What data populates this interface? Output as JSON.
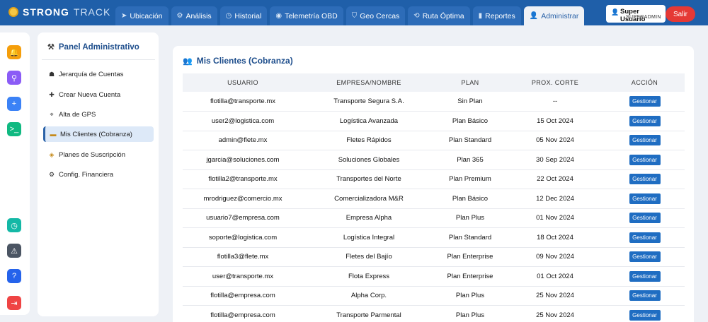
{
  "app": {
    "brand_primary": "STRONG",
    "brand_secondary": "TRACK"
  },
  "nav": {
    "tabs": [
      {
        "label": "Ubicación",
        "icon": "send-icon"
      },
      {
        "label": "Análisis",
        "icon": "gear-icon"
      },
      {
        "label": "Historial",
        "icon": "clock-icon"
      },
      {
        "label": "Telemetría OBD",
        "icon": "gauge-icon"
      },
      {
        "label": "Geo Cercas",
        "icon": "shield-icon"
      },
      {
        "label": "Ruta Óptima",
        "icon": "route-icon"
      },
      {
        "label": "Reportes",
        "icon": "bar-chart-icon"
      },
      {
        "label": "Administrar",
        "icon": "user-tie-icon"
      }
    ],
    "active_tab": "Administrar"
  },
  "user": {
    "name": "Super Usuario",
    "role": "SUPERADMIN",
    "logout_label": "Salir"
  },
  "rail": {
    "items": [
      {
        "icon": "bell-icon",
        "color": "#f59e0b"
      },
      {
        "icon": "location-pin-icon",
        "color": "#8b5cf6"
      },
      {
        "icon": "add-user-icon",
        "color": "#3b82f6"
      },
      {
        "icon": "terminal-icon",
        "color": "#10b981"
      },
      {
        "icon": "clock-icon",
        "color": "#14b8a6"
      },
      {
        "icon": "warning-icon",
        "color": "#4b5563"
      },
      {
        "icon": "help-icon",
        "color": "#2563eb"
      },
      {
        "icon": "logout-icon",
        "color": "#ef4444"
      }
    ]
  },
  "panel": {
    "title": "Panel Administrativo",
    "items": [
      {
        "label": "Jerarquía de Cuentas",
        "icon": "hierarchy-icon"
      },
      {
        "label": "Crear Nueva Cuenta",
        "icon": "plus-icon"
      },
      {
        "label": "Alta de GPS",
        "icon": "satellite-icon"
      },
      {
        "label": "Mis Clientes (Cobranza)",
        "icon": "credit-card-icon"
      },
      {
        "label": "Planes de Suscripción",
        "icon": "tag-icon"
      },
      {
        "label": "Config. Financiera",
        "icon": "settings-icon"
      }
    ],
    "active_item": "Mis Clientes (Cobranza)"
  },
  "main": {
    "title": "Mis Clientes (Cobranza)",
    "columns": [
      "USUARIO",
      "EMPRESA/NOMBRE",
      "PLAN",
      "PROX. CORTE",
      "ACCIÓN"
    ],
    "action_label": "Gestionar",
    "rows": [
      [
        "flotilla@transporte.mx",
        "Transporte Segura S.A.",
        "Sin Plan",
        "--"
      ],
      [
        "user2@logistica.com",
        "Logística Avanzada",
        "Plan Básico",
        "15 Oct 2024"
      ],
      [
        "admin@flete.mx",
        "Fletes Rápidos",
        "Plan Standard",
        "05 Nov 2024"
      ],
      [
        "jgarcia@soluciones.com",
        "Soluciones Globales",
        "Plan 365",
        "30 Sep 2024"
      ],
      [
        "flotilla2@transporte.mx",
        "Transportes del Norte",
        "Plan Premium",
        "22 Oct 2024"
      ],
      [
        "mrodriguez@comercio.mx",
        "Comercializadora M&R",
        "Plan Básico",
        "12 Dec 2024"
      ],
      [
        "usuario7@empresa.com",
        "Empresa Alpha",
        "Plan Plus",
        "01 Nov 2024"
      ],
      [
        "soporte@logistica.com",
        "Logística Integral",
        "Plan Standard",
        "18 Oct 2024"
      ],
      [
        "flotilla3@flete.mx",
        "Fletes del Bajío",
        "Plan Enterprise",
        "09 Nov 2024"
      ],
      [
        "user@transporte.mx",
        "Flota Express",
        "Plan Enterprise",
        "01 Oct 2024"
      ],
      [
        "flotilla@empresa.com",
        "Alpha Corp.",
        "Plan Plus",
        "25 Nov 2024"
      ],
      [
        "flotilla@empresa.com",
        "Transporte Parmental",
        "Plan Plus",
        "25 Nov 2024"
      ]
    ]
  }
}
